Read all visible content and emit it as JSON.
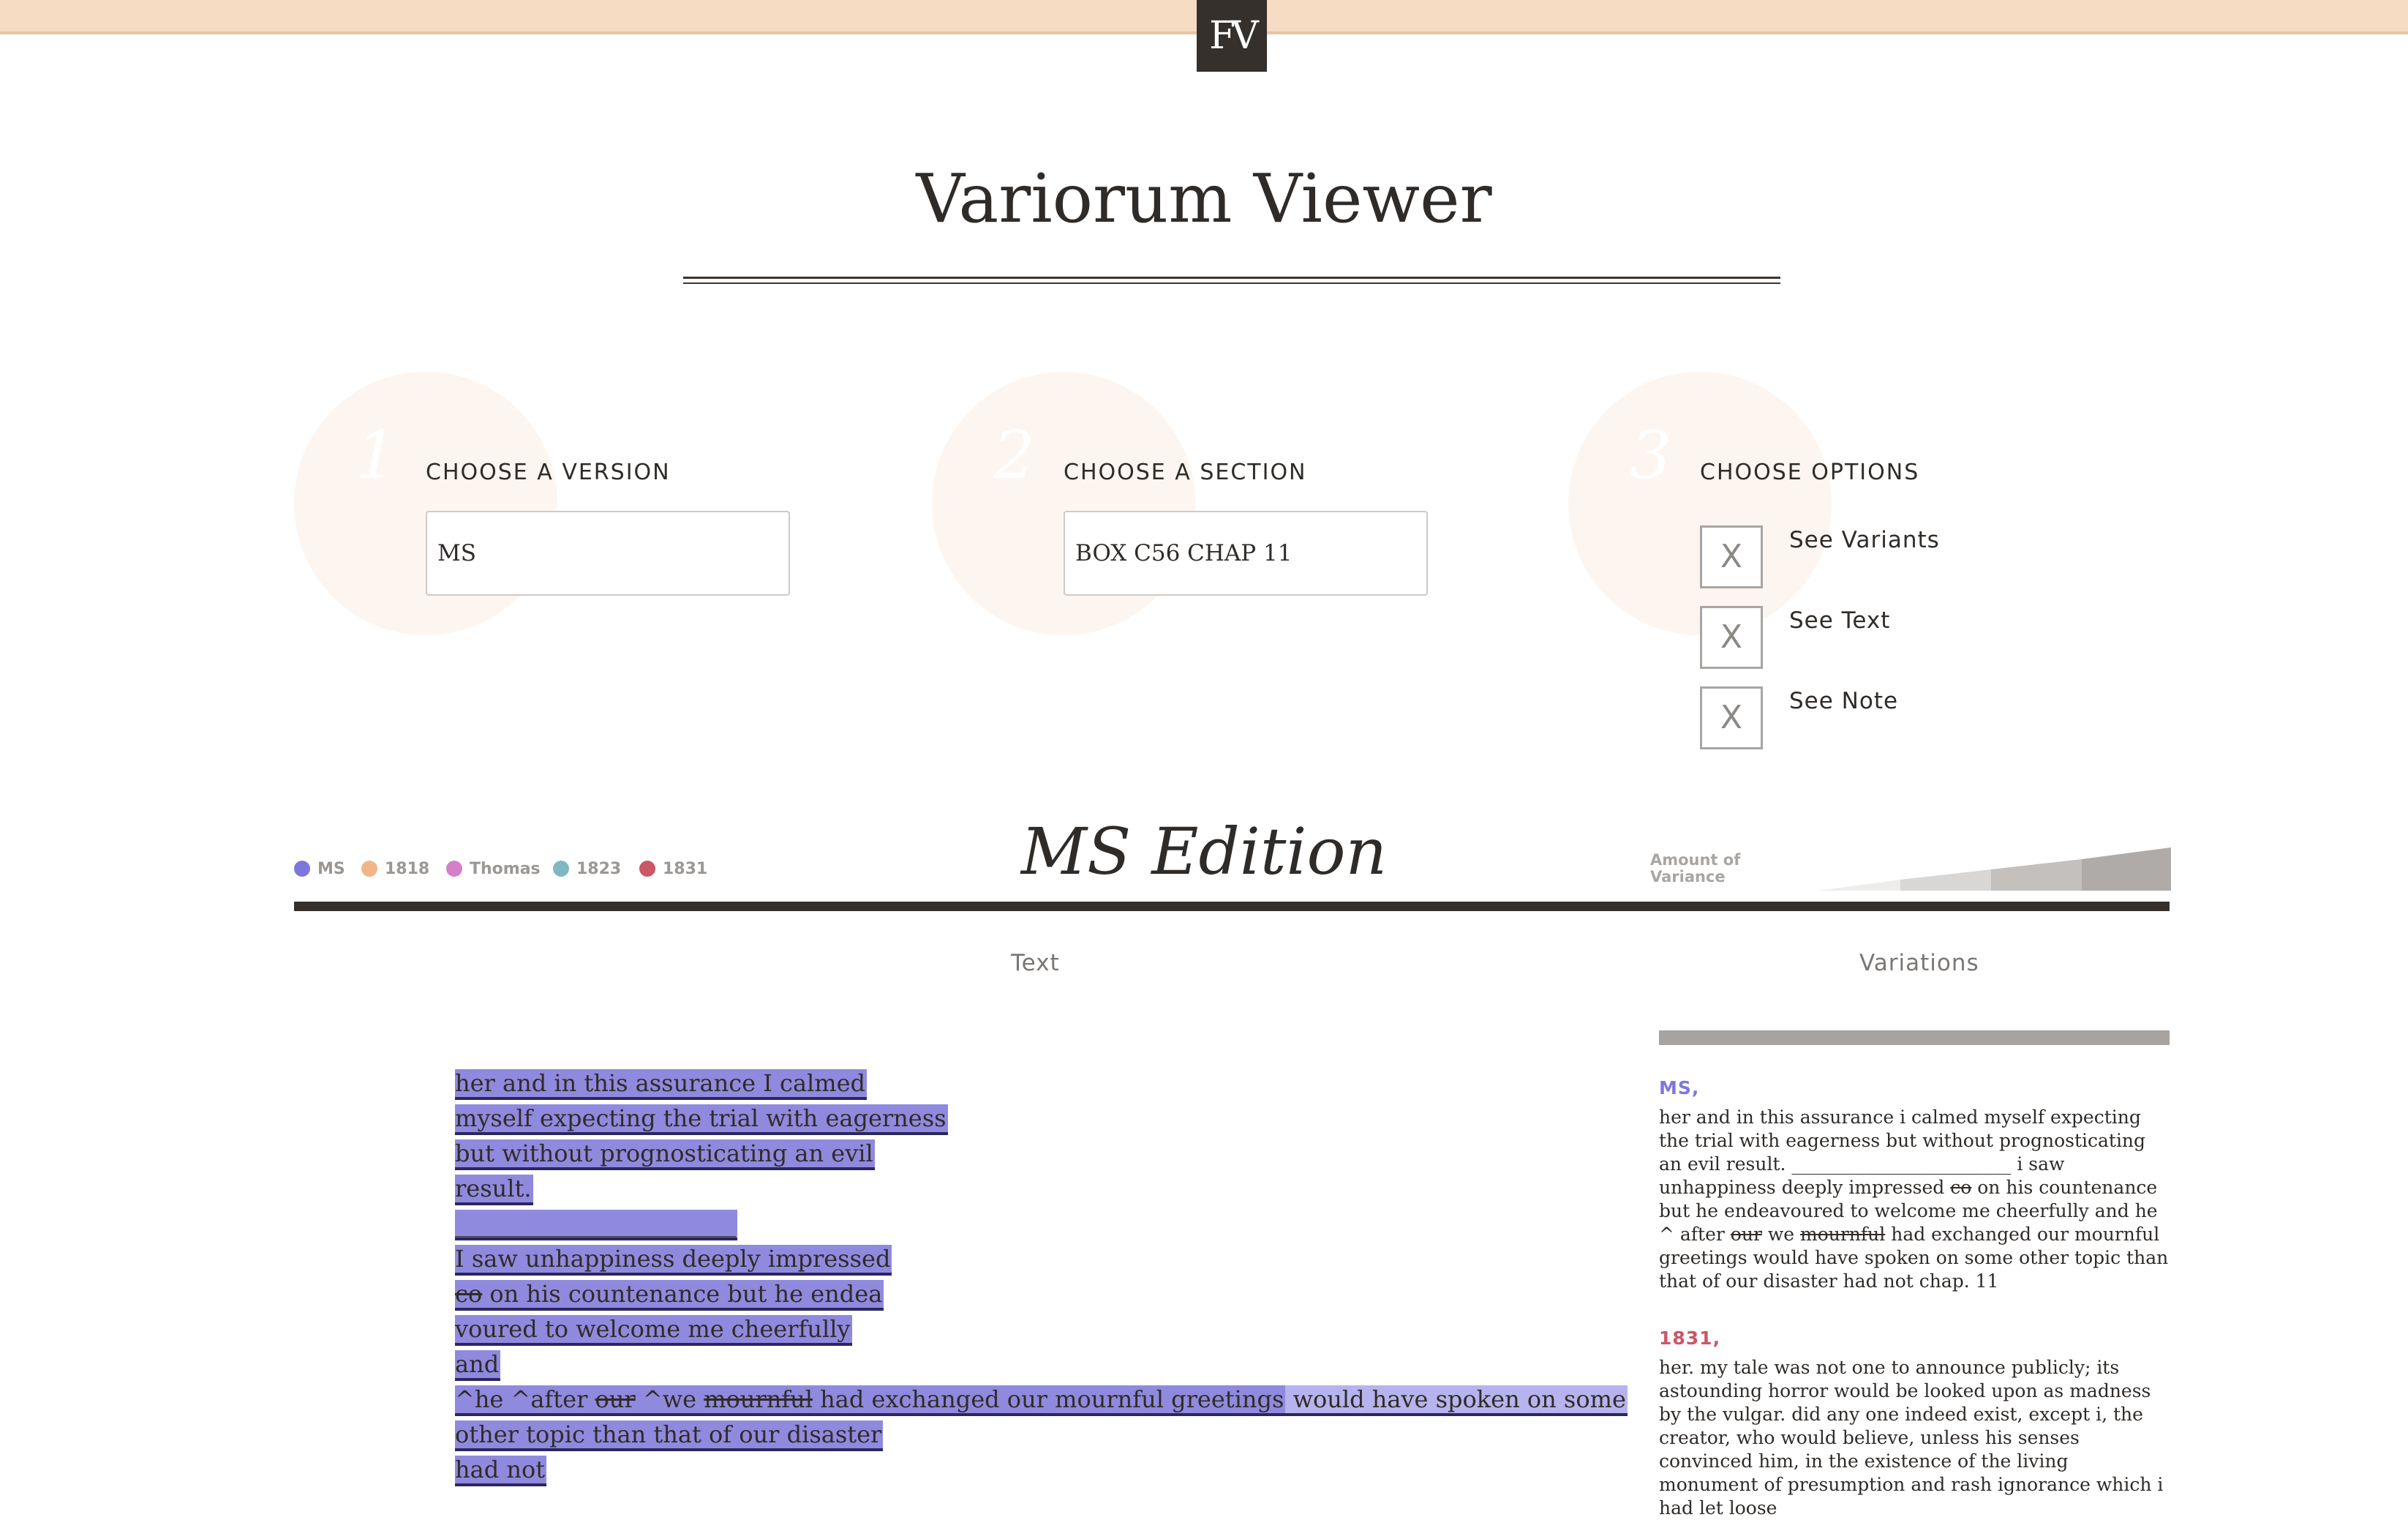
{
  "header": {
    "logo_text": "FV"
  },
  "title": "Variorum Viewer",
  "steps": [
    {
      "number": "1",
      "label": "CHOOSE A VERSION",
      "value": "MS"
    },
    {
      "number": "2",
      "label": "CHOOSE A SECTION",
      "value": "BOX C56 CHAP 11"
    },
    {
      "number": "3",
      "label": "CHOOSE OPTIONS"
    }
  ],
  "options": [
    {
      "mark": "X",
      "label": "See Variants"
    },
    {
      "mark": "X",
      "label": "See Text"
    },
    {
      "mark": "X",
      "label": "See Note"
    }
  ],
  "legend": [
    {
      "label": "MS",
      "color": "#7c78db"
    },
    {
      "label": "1818",
      "color": "#f2b587"
    },
    {
      "label": "Thomas",
      "color": "#d57fc8"
    },
    {
      "label": "1823",
      "color": "#7fb7c2"
    },
    {
      "label": "1831",
      "color": "#c95766"
    }
  ],
  "edition_title": "MS Edition",
  "variance": {
    "label_line1": "Amount of",
    "label_line2": "Variance"
  },
  "columns": {
    "text": "Text",
    "variations": "Variations"
  },
  "text_lines": {
    "l1": "her and in this assurance I calmed",
    "l2": "myself expecting the trial with eagerness",
    "l3": "but without prognosticating an evil",
    "l4": "result.",
    "l5": "________________________",
    "l6": "I saw unhappiness deeply impressed",
    "l7_strike": "co",
    "l7_rest": " on his countenance but he endea",
    "l8": "voured to welcome me cheerfully",
    "l9": "and",
    "l10_a": "^he ^after ",
    "l10_b": "our",
    "l10_c": " ^we ",
    "l10_d": "mournful",
    "l10_e": " had exchanged our mournful greetings",
    "l10_f": " would have spoken on some",
    "l11": "other topic than that of our disaster",
    "l12": "had not"
  },
  "variations": {
    "ms_source": "MS,",
    "ms_text_a": "her and in this assurance i calmed myself expecting the trial with eagerness but without prognosticating an evil result. ________________________ i saw unhappiness deeply impressed ",
    "ms_text_strike1": "co",
    "ms_text_b": " on his countenance but he endeavoured to welcome me cheerfully and he ^ after ",
    "ms_text_strike2": "our",
    "ms_text_c": " we ",
    "ms_text_strike3": "mournful",
    "ms_text_d": " had exchanged our mournful greetings would have spoken on some other topic than that of our disaster had not chap. 11",
    "v1831_source": "1831,",
    "v1831_text": "her. my tale was not one to announce publicly; its astounding horror would be looked upon as madness by the vulgar. did any one indeed exist, except i, the creator, who would believe, unless his senses convinced him, in the existence of the living monument of presumption and rash ignorance which i had let loose"
  }
}
